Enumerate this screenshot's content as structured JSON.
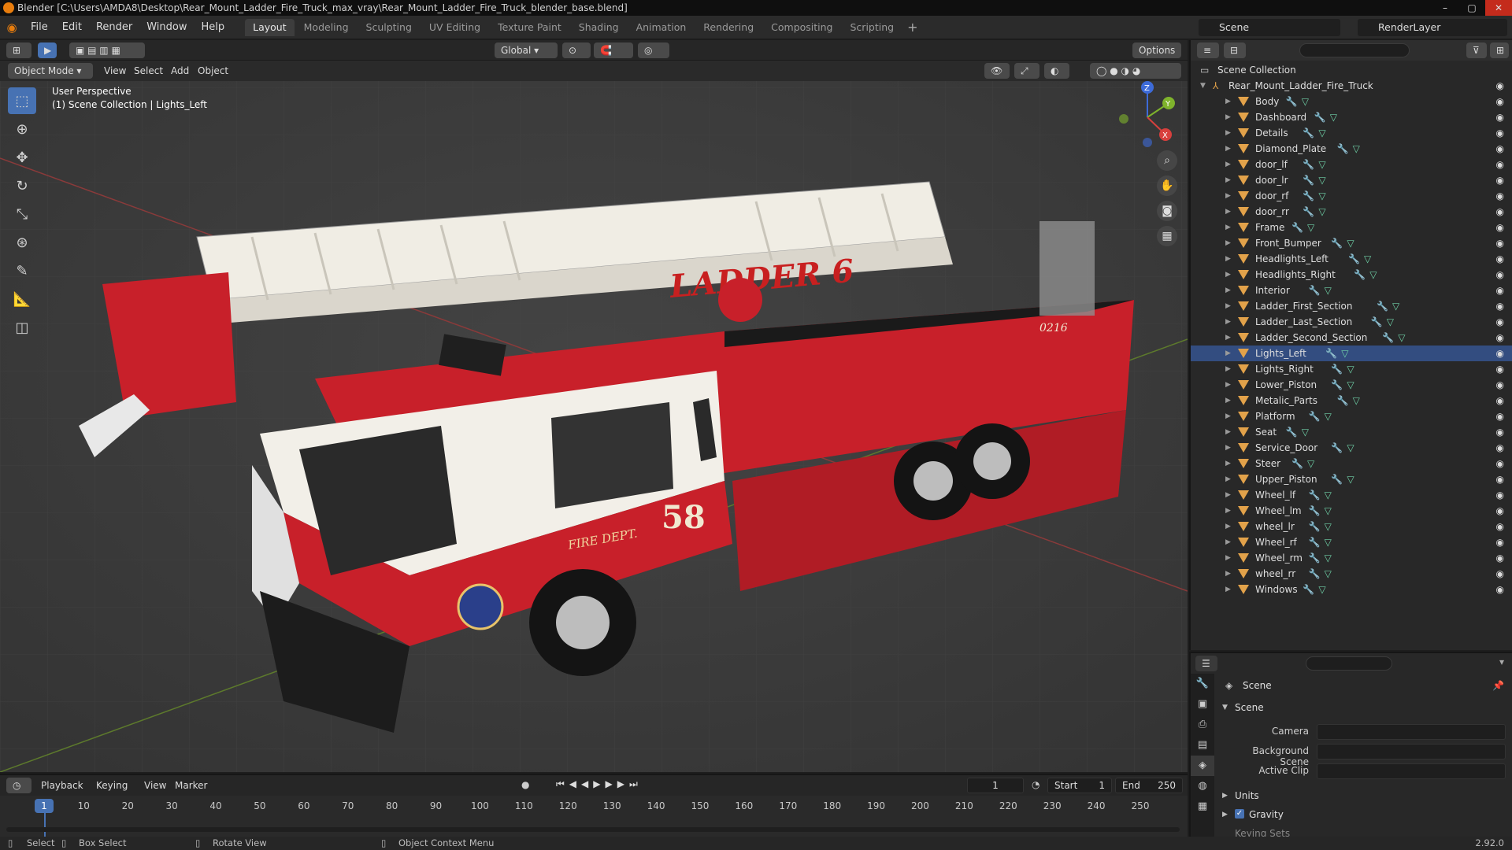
{
  "titlebar": {
    "title": "Blender [C:\\Users\\AMDA8\\Desktop\\Rear_Mount_Ladder_Fire_Truck_max_vray\\Rear_Mount_Ladder_Fire_Truck_blender_base.blend]"
  },
  "menu": {
    "items": [
      "File",
      "Edit",
      "Render",
      "Window",
      "Help"
    ],
    "workspaces": [
      "Layout",
      "Modeling",
      "Sculpting",
      "UV Editing",
      "Texture Paint",
      "Shading",
      "Animation",
      "Rendering",
      "Compositing",
      "Scripting"
    ],
    "active_workspace": "Layout",
    "scene": "Scene",
    "view_layer": "RenderLayer"
  },
  "viewport_header": {
    "orientation": "Global",
    "options": "Options",
    "mode": "Object Mode",
    "menus": [
      "View",
      "Select",
      "Add",
      "Object"
    ]
  },
  "viewport": {
    "view_name": "User Perspective",
    "collection_info": "(1) Scene Collection | Lights_Left",
    "truck_label": "LADDER 6",
    "truck_number": "58",
    "fire_dept": "FIRE DEPT.",
    "unit_number": "0216",
    "gizmo_axes": [
      "Z",
      "Y",
      "X"
    ]
  },
  "outliner": {
    "root": "Scene Collection",
    "collection": "Rear_Mount_Ladder_Fire_Truck",
    "objects": [
      "Body",
      "Dashboard",
      "Details",
      "Diamond_Plate",
      "door_lf",
      "door_lr",
      "door_rf",
      "door_rr",
      "Frame",
      "Front_Bumper",
      "Headlights_Left",
      "Headlights_Right",
      "Interior",
      "Ladder_First_Section",
      "Ladder_Last_Section",
      "Ladder_Second_Section",
      "Lights_Left",
      "Lights_Right",
      "Lower_Piston",
      "Metalic_Parts",
      "Platform",
      "Seat",
      "Service_Door",
      "Steer",
      "Upper_Piston",
      "Wheel_lf",
      "Wheel_lm",
      "wheel_lr",
      "Wheel_rf",
      "Wheel_rm",
      "wheel_rr",
      "Windows"
    ],
    "selected": "Lights_Left"
  },
  "properties": {
    "context": "Scene",
    "panel": "Scene",
    "fields": {
      "camera_label": "Camera",
      "background_label": "Background Scene",
      "clip_label": "Active Clip"
    },
    "units": "Units",
    "gravity": "Gravity",
    "gravity_checked": true,
    "keying_sets": "Keying Sets"
  },
  "timeline": {
    "menus": [
      "Playback",
      "Keying",
      "View",
      "Marker"
    ],
    "current_frame": "1",
    "start_label": "Start",
    "start": "1",
    "end_label": "End",
    "end": "250",
    "ticks": [
      "1",
      "10",
      "20",
      "30",
      "40",
      "50",
      "60",
      "70",
      "80",
      "90",
      "100",
      "110",
      "120",
      "130",
      "140",
      "150",
      "160",
      "170",
      "180",
      "190",
      "200",
      "210",
      "220",
      "230",
      "240",
      "250"
    ]
  },
  "statusbar": {
    "select": "Select",
    "box_select": "Box Select",
    "rotate": "Rotate View",
    "context_menu": "Object Context Menu",
    "version": "2.92.0"
  },
  "colors": {
    "accent": "#4772b3",
    "selected_row": "#334d80",
    "object_icon": "#e2a24a",
    "truck_red": "#c8202a"
  }
}
